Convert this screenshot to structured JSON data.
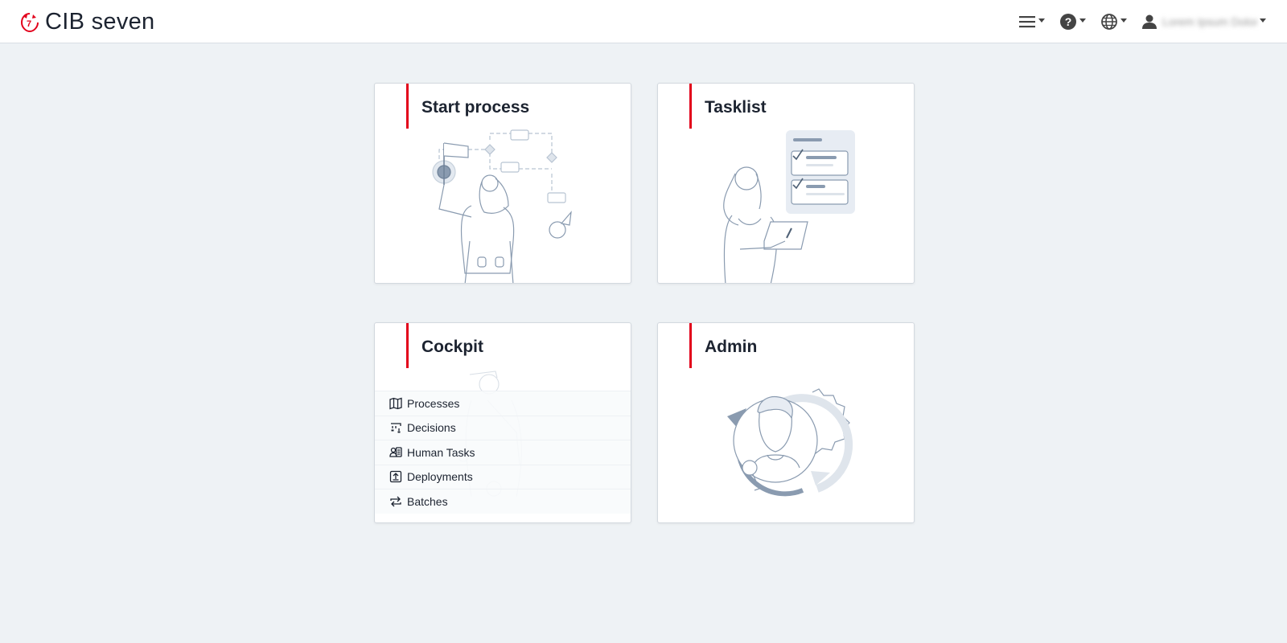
{
  "app": {
    "name": "CIB seven",
    "accent_color": "#e2001a",
    "background_color": "#eef2f5"
  },
  "header": {
    "menu_icon": "hamburger-icon",
    "help_icon": "help-icon",
    "language_icon": "globe-icon",
    "user_icon": "user-icon",
    "user_name": "Lorem Ipsum Dolor"
  },
  "cards": {
    "start_process": {
      "title": "Start process"
    },
    "tasklist": {
      "title": "Tasklist"
    },
    "cockpit": {
      "title": "Cockpit",
      "items": [
        {
          "label": "Processes",
          "icon": "map-icon"
        },
        {
          "label": "Decisions",
          "icon": "decision-icon"
        },
        {
          "label": "Human Tasks",
          "icon": "human-tasks-icon"
        },
        {
          "label": "Deployments",
          "icon": "deployment-icon"
        },
        {
          "label": "Batches",
          "icon": "batches-icon"
        }
      ]
    },
    "admin": {
      "title": "Admin"
    }
  }
}
